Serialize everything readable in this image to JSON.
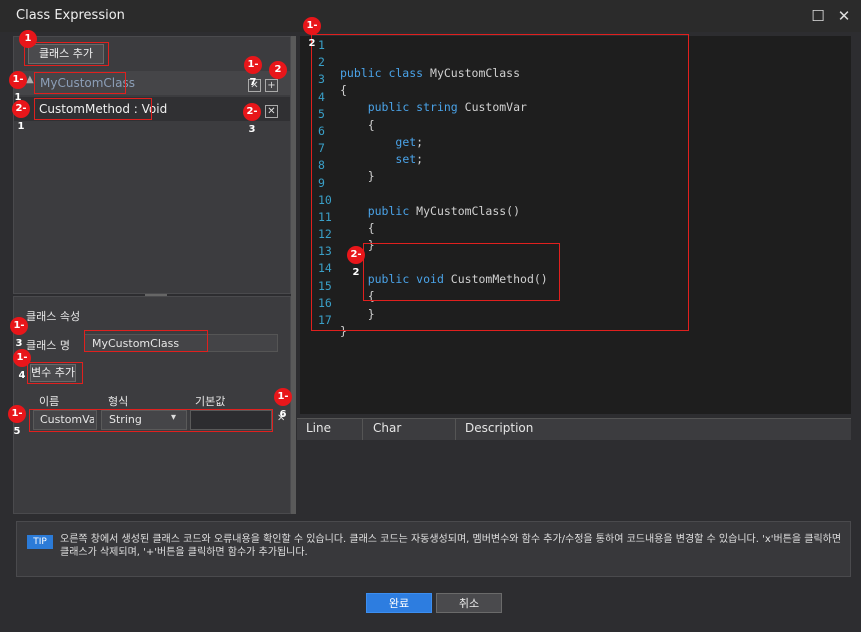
{
  "window": {
    "title": "Class Expression",
    "maximize": "☐",
    "close": "✕"
  },
  "class_list": {
    "add_class_label": "클래스 추가",
    "class_name": "MyCustomClass",
    "method_label": "CustomMethod : Void",
    "remove_icon": "✕",
    "add_icon": "+"
  },
  "class_props": {
    "section_title": "클래스 속성",
    "name_label": "클래스 명",
    "name_value": "MyCustomClass",
    "add_var_label": "변수 추가",
    "columns": [
      "이름",
      "형식",
      "기본값"
    ],
    "var_name": "CustomVar",
    "var_type": "String",
    "var_default": "",
    "dropdown_icon": "▾",
    "remove_icon": "✕"
  },
  "editor": {
    "line_numbers": [
      "1",
      "2",
      "3",
      "4",
      "5",
      "6",
      "7",
      "8",
      "9",
      "10",
      "11",
      "12",
      "13",
      "14",
      "15",
      "16",
      "17"
    ],
    "lines": [
      [
        {
          "k": 1,
          "t": "public class "
        },
        {
          "k": 0,
          "t": "MyCustomClass"
        }
      ],
      [
        {
          "k": 0,
          "t": "{"
        }
      ],
      [
        {
          "k": 0,
          "t": "    "
        },
        {
          "k": 1,
          "t": "public string "
        },
        {
          "k": 0,
          "t": "CustomVar"
        }
      ],
      [
        {
          "k": 0,
          "t": "    {"
        }
      ],
      [
        {
          "k": 0,
          "t": "        "
        },
        {
          "k": 1,
          "t": "get"
        },
        {
          "k": 0,
          "t": ";"
        }
      ],
      [
        {
          "k": 0,
          "t": "        "
        },
        {
          "k": 1,
          "t": "set"
        },
        {
          "k": 0,
          "t": ";"
        }
      ],
      [
        {
          "k": 0,
          "t": "    }"
        }
      ],
      [
        {
          "k": 0,
          "t": ""
        }
      ],
      [
        {
          "k": 0,
          "t": "    "
        },
        {
          "k": 1,
          "t": "public "
        },
        {
          "k": 0,
          "t": "MyCustomClass()"
        }
      ],
      [
        {
          "k": 0,
          "t": "    {"
        }
      ],
      [
        {
          "k": 0,
          "t": "    }"
        }
      ],
      [
        {
          "k": 0,
          "t": ""
        }
      ],
      [
        {
          "k": 0,
          "t": "    "
        },
        {
          "k": 1,
          "t": "public void "
        },
        {
          "k": 0,
          "t": "CustomMethod()"
        }
      ],
      [
        {
          "k": 0,
          "t": "    {"
        }
      ],
      [
        {
          "k": 0,
          "t": "    }"
        }
      ],
      [
        {
          "k": 0,
          "t": "}"
        }
      ],
      [
        {
          "k": 0,
          "t": ""
        }
      ]
    ]
  },
  "error_list": {
    "columns": [
      "Line",
      "Char",
      "Description"
    ]
  },
  "tip": {
    "badge": "TIP",
    "text": "오른쪽 창에서 생성된 클래스 코드와 오류내용을 확인할 수 있습니다. 클래스 코드는 자동생성되며, 멤버변수와 함수 추가/수정을 통하여 코드내용을 변경할 수 있습니다. 'x'버튼을 클릭하면 클래스가 삭제되며, '+'버튼을 클릭하면 함수가 추가됩니다."
  },
  "buttons": {
    "ok": "완료",
    "cancel": "취소"
  },
  "badges": [
    "1",
    "1-1",
    "1-2",
    "1-3",
    "1-4",
    "1-5",
    "1-6",
    "1-7",
    "2",
    "2-1",
    "2-2",
    "2-3"
  ],
  "colors": {
    "accent": "#2d7de0",
    "annotation": "#e8161a",
    "keyword": "#4aa3e8",
    "line_number": "#3aa0c8"
  }
}
